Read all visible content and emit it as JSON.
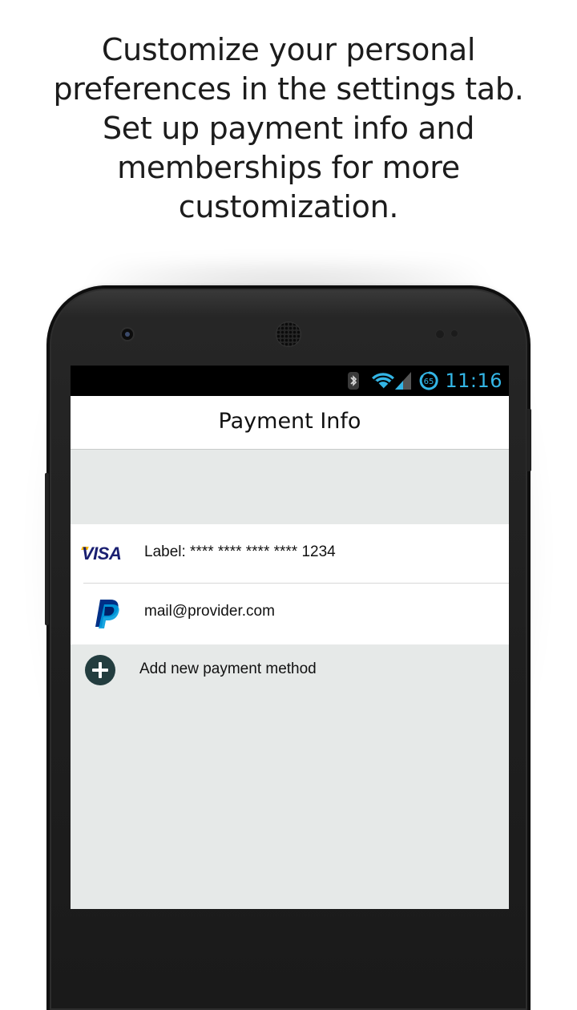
{
  "promo": {
    "lines": [
      "Customize your personal",
      "preferences in the settings tab.",
      "Set up payment info and",
      "memberships for more",
      "customization."
    ]
  },
  "statusbar": {
    "time": "11:16",
    "battery_level": "65",
    "icons": [
      "bluetooth-icon",
      "wifi-icon",
      "signal-icon",
      "battery-icon"
    ],
    "accent_color": "#33b5e5"
  },
  "appbar": {
    "title": "Payment Info"
  },
  "payment_methods": [
    {
      "brand": "VISA",
      "icon": "visa-logo",
      "label": "Label: **** **** **** **** 1234"
    },
    {
      "brand": "PayPal",
      "icon": "paypal-logo",
      "label": "mail@provider.com"
    }
  ],
  "add_payment": {
    "label": "Add new payment method",
    "icon": "plus-circle-icon",
    "icon_color": "#233d3f"
  }
}
